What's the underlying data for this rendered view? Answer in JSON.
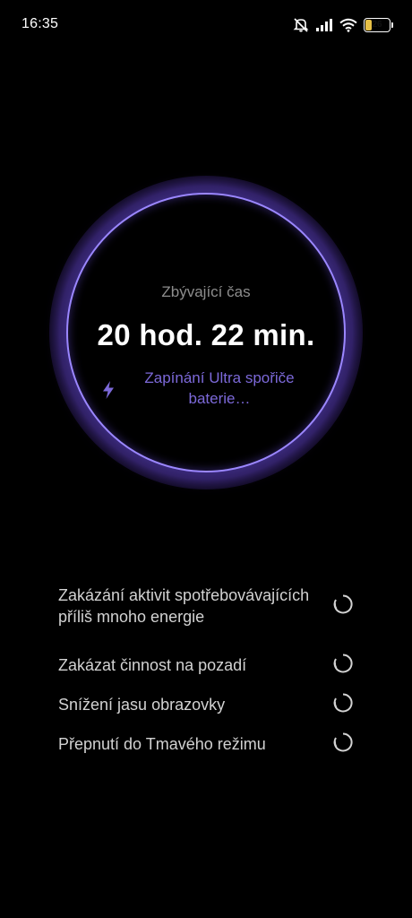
{
  "status_bar": {
    "time": "16:35",
    "icons": [
      "mute-icon",
      "signal-icon",
      "wifi-icon",
      "battery-icon"
    ],
    "battery_level": "26",
    "battery_fraction": 0.26,
    "battery_color": "#e7c046"
  },
  "ring": {
    "label": "Zbývající čas",
    "value": "20 hod. 22 min.",
    "action_icon": "bolt-icon",
    "action_text": "Zapínání Ultra spořiče baterie…",
    "ring_color": "#9b87ff",
    "action_color": "#7c69d9"
  },
  "tasks": [
    {
      "label": "Zakázání aktivit spotřebovávajících příliš mnoho energie",
      "state": "loading"
    },
    {
      "label": "Zakázat činnost na pozadí",
      "state": "loading"
    },
    {
      "label": "Snížení jasu obrazovky",
      "state": "loading"
    },
    {
      "label": "Přepnutí do Tmavého režimu",
      "state": "loading"
    }
  ]
}
